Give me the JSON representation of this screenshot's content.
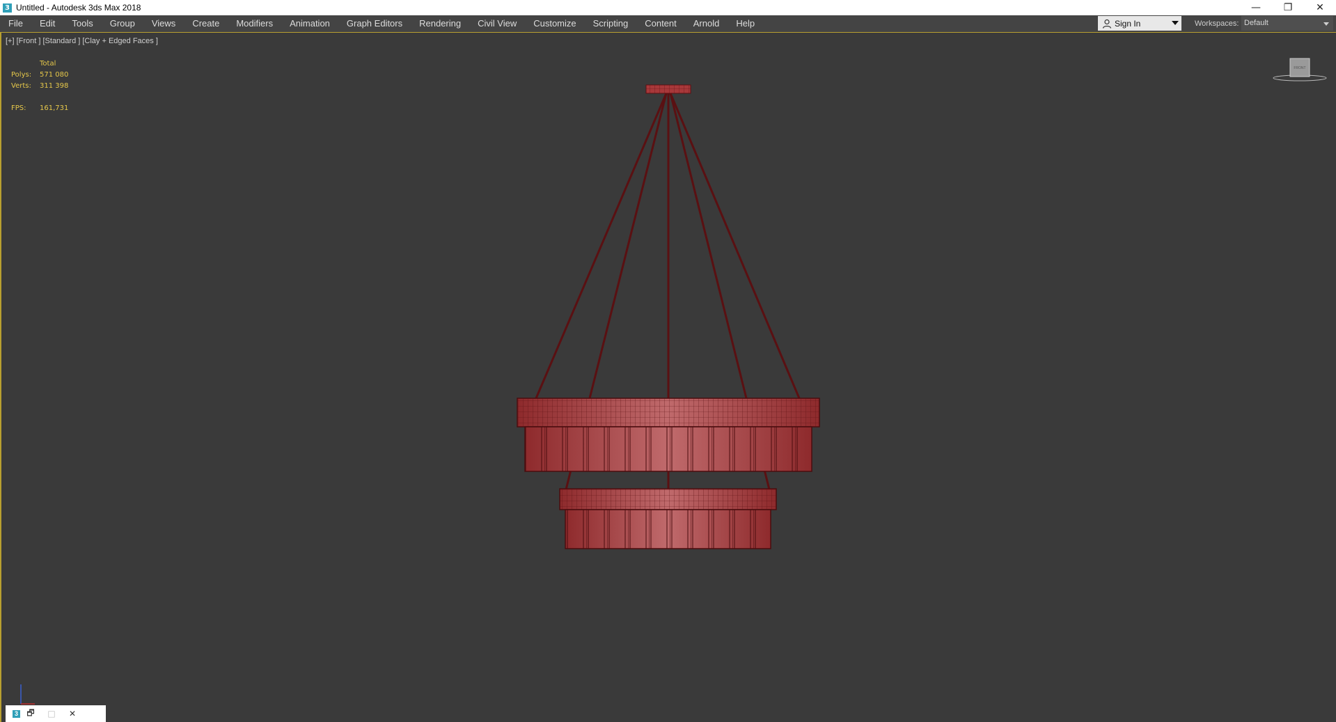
{
  "window": {
    "title": "Untitled - Autodesk 3ds Max 2018",
    "app_icon": "3",
    "controls": {
      "minimize": "—",
      "restore": "❐",
      "close": "✕"
    }
  },
  "menu": {
    "items": [
      "File",
      "Edit",
      "Tools",
      "Group",
      "Views",
      "Create",
      "Modifiers",
      "Animation",
      "Graph Editors",
      "Rendering",
      "Civil View",
      "Customize",
      "Scripting",
      "Content",
      "Arnold",
      "Help"
    ],
    "sign_in": "Sign In",
    "workspaces_label": "Workspaces:",
    "workspace_value": "Default"
  },
  "viewport": {
    "label": "[+] [Front ] [Standard ] [Clay + Edged Faces ]",
    "stats": {
      "header": "Total",
      "polys_label": "Polys:",
      "polys_value": "571 080",
      "verts_label": "Verts:",
      "verts_value": "311 398",
      "fps_label": "FPS:",
      "fps_value": "161,731"
    },
    "viewcube_label": "FRONT"
  },
  "minimized_window": {
    "icon": "3",
    "restore": "🗗",
    "maximize": "□",
    "close": "✕"
  },
  "colors": {
    "viewport_bg": "#3a3a3a",
    "stats_text": "#e6c84a",
    "model_red": "#a8383a",
    "model_wire": "#5a1012",
    "accent": "#b8a030"
  }
}
